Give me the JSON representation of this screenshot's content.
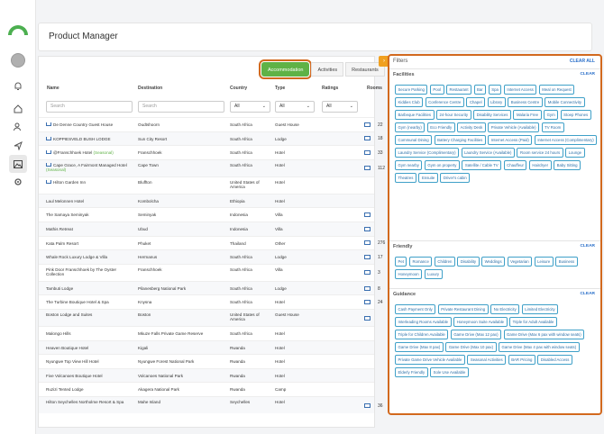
{
  "app": {
    "title": "Product Manager"
  },
  "tabs": [
    "Accommodation",
    "Activities",
    "Restaurants"
  ],
  "table": {
    "columns": [
      "Name",
      "Destination",
      "Country",
      "Type",
      "Ratings",
      "Rooms"
    ],
    "search_placeholder": "Search",
    "select_value": "All",
    "rows": [
      {
        "name": "De Denne Country Guest House",
        "dest": "Oudtshoorn",
        "country": "South Africa",
        "type": "Guest House",
        "crown": true,
        "seasonal": "",
        "rooms": "22"
      },
      {
        "name": "KOPPIESVELD BUSH LODGE",
        "dest": "Sun City Resort",
        "country": "South Africa",
        "type": "Lodge",
        "crown": true,
        "seasonal": "",
        "rooms": "18"
      },
      {
        "name": "@Franschhoek Hotel",
        "dest": "Franschhoek",
        "country": "South Africa",
        "type": "Hotel",
        "crown": true,
        "seasonal": "(Seasonal)",
        "rooms": "33"
      },
      {
        "name": "Cape Grace, A Fairmont Managed Hotel",
        "dest": "Cape Town",
        "country": "South Africa",
        "type": "Hotel",
        "crown": true,
        "seasonal": "(Seasonal)",
        "rooms": "112"
      },
      {
        "name": "Hilton Garden Inn",
        "dest": "Bluffton",
        "country": "United States of America",
        "type": "Hotel",
        "crown": true,
        "seasonal": "",
        "rooms": ""
      },
      {
        "name": "Laul Melonnen Hotel",
        "dest": "Kombolcha",
        "country": "Ethiopia",
        "type": "Hotel",
        "crown": false,
        "seasonal": "",
        "rooms": ""
      },
      {
        "name": "The Samaya Seminyak",
        "dest": "Seminyak",
        "country": "Indonesia",
        "type": "Villa",
        "crown": false,
        "seasonal": "",
        "rooms": ""
      },
      {
        "name": "Mathis Retreat",
        "dest": "Ubud",
        "country": "Indonesia",
        "type": "Villa",
        "crown": false,
        "seasonal": "",
        "rooms": ""
      },
      {
        "name": "Kata Palm Resort",
        "dest": "Phuket",
        "country": "Thailand",
        "type": "Other",
        "crown": false,
        "seasonal": "",
        "rooms": "276"
      },
      {
        "name": "Whale Rock Luxury Lodge & Villa",
        "dest": "Hermanus",
        "country": "South Africa",
        "type": "Lodge",
        "crown": false,
        "seasonal": "",
        "rooms": "17"
      },
      {
        "name": "Pink Door Franschhoek by The Oyster Collection",
        "dest": "Franschhoek",
        "country": "South Africa",
        "type": "Villa",
        "crown": false,
        "seasonal": "",
        "rooms": "3"
      },
      {
        "name": "Tambuti Lodge",
        "dest": "Pilanesberg National Park",
        "country": "South Africa",
        "type": "Lodge",
        "crown": false,
        "seasonal": "",
        "rooms": "8"
      },
      {
        "name": "The Turbine Boutique Hotel & Spa",
        "dest": "Knysna",
        "country": "South Africa",
        "type": "Hotel",
        "crown": false,
        "seasonal": "",
        "rooms": "24"
      },
      {
        "name": "Boston Lodge and Suites",
        "dest": "Boston",
        "country": "United States of America",
        "type": "Guest House",
        "crown": false,
        "seasonal": "",
        "rooms": ""
      },
      {
        "name": "Malongo Hills",
        "dest": "Mkuze Falls Private Game Reserve",
        "country": "South Africa",
        "type": "Hotel",
        "crown": false,
        "seasonal": "",
        "rooms": ""
      },
      {
        "name": "Heaven Boutique Hotel",
        "dest": "Kigali",
        "country": "Rwanda",
        "type": "Hotel",
        "crown": false,
        "seasonal": "",
        "rooms": ""
      },
      {
        "name": "Nyungwe Top View Hill Hotel",
        "dest": "Nyungwe Forest National Park",
        "country": "Rwanda",
        "type": "Hotel",
        "crown": false,
        "seasonal": "",
        "rooms": ""
      },
      {
        "name": "Five Volcanoes Boutique Hotel",
        "dest": "Volcanoes National Park",
        "country": "Rwanda",
        "type": "Hotel",
        "crown": false,
        "seasonal": "",
        "rooms": ""
      },
      {
        "name": "Ruzizi Tented Lodge",
        "dest": "Akagera National Park",
        "country": "Rwanda",
        "type": "Camp",
        "crown": false,
        "seasonal": "",
        "rooms": ""
      },
      {
        "name": "Hilton Seychelles Northolme Resort & Spa",
        "dest": "Mahe Island",
        "country": "Seychelles",
        "type": "Hotel",
        "crown": false,
        "seasonal": "",
        "rooms": "36"
      }
    ]
  },
  "filters": {
    "title": "Filters",
    "clear_all": "CLEAR ALL",
    "clear": "CLEAR",
    "handle": "›",
    "sections": [
      {
        "name": "Facilities",
        "tags": [
          "Secure Parking",
          "Pool",
          "Restaurant",
          "Bar",
          "Spa",
          "Internet Access",
          "Meal on Request",
          "Kiddies Club",
          "Conference Centre",
          "Chapel",
          "Library",
          "Business Centre",
          "Mobile Connectivity",
          "Barbeque Facilities",
          "24-hour Security",
          "Disability Services",
          "Malaria Free",
          "Gym",
          "Stoep Phones",
          "Gym (nearby)",
          "Eco Friendly",
          "Activity Desk",
          "Private Vehicle (Available)",
          "TV Room",
          "Communal Dining",
          "Battery Charging Facilities",
          "Internet Access (Paid)",
          "Internet Access (Complimentary)",
          "Laundry Service (Complimentary)",
          "Laundry Service (Available)",
          "Room service 24 hours",
          "Lounge",
          "Gym nearby",
          "Gym on property",
          "Satellite / Cable TV",
          "Chauffeur",
          "Hairdryer",
          "Baby Sitting",
          "Theatres",
          "Ensuite",
          "Driver's cabin"
        ]
      },
      {
        "name": "Friendly",
        "tags": [
          "Pet",
          "Romance",
          "Children",
          "Disability",
          "Weddings",
          "Vegetarian",
          "Leisure",
          "Business",
          "Honeymoon",
          "Luxury"
        ]
      },
      {
        "name": "Guidance",
        "tags": [
          "Cash Payment Only",
          "Private Restaurant Dining",
          "No Electricity",
          "Limited Electricity",
          "Interleading Rooms Available",
          "Honeymoon Suite Available",
          "Triple for Adult Available",
          "Triple for Children Available",
          "Game Drive (Max 12 pax)",
          "Game Drive (Max 6 pax with window seats)",
          "Game Drive (Max 8 pax)",
          "Game Drive (Max 10 pax)",
          "Game Drive (Max 4 pax with window seats)",
          "Private Game Drive Vehicle Available",
          "Seasonal Activities",
          "BAR Pricing",
          "Disabled Access",
          "Elderly Friendly",
          "Sole Use Available"
        ]
      }
    ]
  }
}
